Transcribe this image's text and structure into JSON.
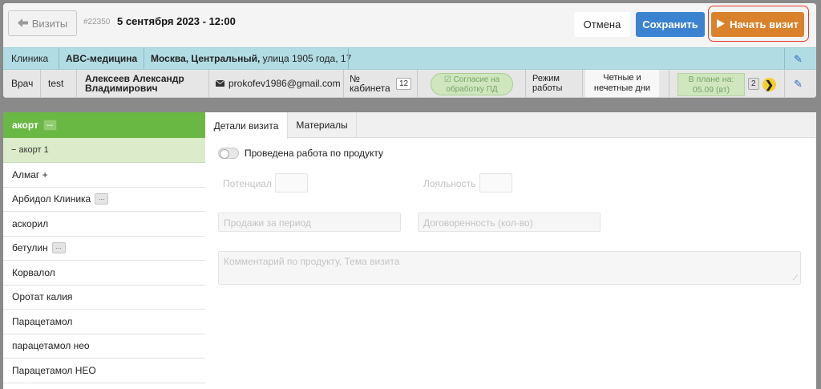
{
  "header": {
    "back_label": "Визиты",
    "visit_id": "#22350",
    "visit_datetime": "5 сентября 2023 - 12:00",
    "cancel_label": "Отмена",
    "save_label": "Сохранить",
    "start_label": "Начать визит"
  },
  "clinic_row": {
    "label": "Клиника",
    "name": "ABC-медицина",
    "address_bold": "Москва, Центральный,",
    "address_rest": " улица 1905 года, 17"
  },
  "doctor_row": {
    "label": "Врач",
    "short": "test",
    "full_name_line1": "Алексеев Александр",
    "full_name_line2": "Владимирович",
    "email": "prokofev1986@gmail.com",
    "cabinet_label_line1": "№",
    "cabinet_label_line2": "кабинета",
    "cabinet_number": "12",
    "consent_line1": "Согласие на",
    "consent_line2": "обработку ПД",
    "schedule_label_line1": "Режим",
    "schedule_label_line2": "работы",
    "schedule_value_line1": "Четные и",
    "schedule_value_line2": "нечетные дни",
    "plan_line1": "В плане на:",
    "plan_line2": "05.09 (вт)",
    "plan_count": "2",
    "next_arrow": "❯"
  },
  "products": {
    "header": "акорт",
    "header_more": "...",
    "sub_item": "− акорт 1",
    "items": [
      {
        "label": "Алмаг +",
        "more": ""
      },
      {
        "label": "Арбидол Клиника",
        "more": "..."
      },
      {
        "label": "аскорил",
        "more": ""
      },
      {
        "label": "бетулин",
        "more": "..."
      },
      {
        "label": "Корвалол",
        "more": ""
      },
      {
        "label": "Оротат калия",
        "more": ""
      },
      {
        "label": "Парацетамол",
        "more": ""
      },
      {
        "label": "парацетамол нео",
        "more": ""
      },
      {
        "label": "Парацетамол НЕО",
        "more": ""
      }
    ]
  },
  "tabs": {
    "details": "Детали визита",
    "materials": "Материалы"
  },
  "form": {
    "toggle_label": "Проведена работа по продукту",
    "potential_label": "Потенциал",
    "loyalty_label": "Лояльность",
    "sales_placeholder": "Продажи за период",
    "agreement_placeholder": "Договоренность (кол-во)",
    "comment_placeholder": "Комментарий по продукту, Тема визита"
  },
  "colors": {
    "accent_green": "#6ab844",
    "save_blue": "#3b82d0",
    "start_orange": "#d9822b",
    "clinic_row_bg": "#b2dce4"
  }
}
